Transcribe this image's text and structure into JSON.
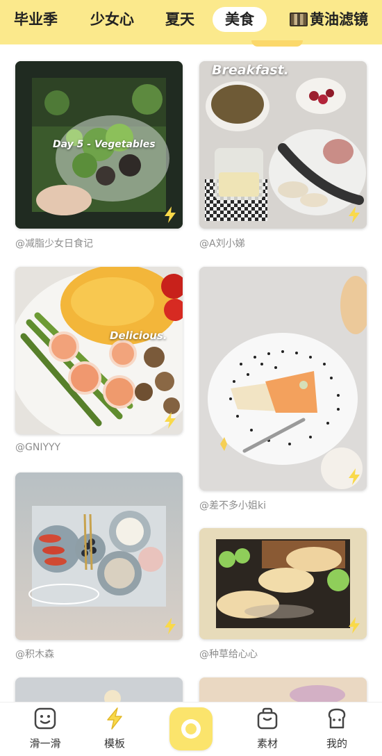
{
  "tabs": [
    {
      "label": "毕业季",
      "active": false
    },
    {
      "label": "少女心",
      "active": false
    },
    {
      "label": "夏天",
      "active": false
    },
    {
      "label": "美食",
      "active": true
    },
    {
      "label": "黄油滤镜",
      "active": false,
      "icon": "film-strip-icon"
    }
  ],
  "posts": [
    {
      "author": "@减脂少女日食记",
      "image_text": "Day 5 - Vegetables",
      "badge_icon": "lightning-icon"
    },
    {
      "author": "@A刘小娣",
      "image_text": "Breakfast.",
      "badge_icon": "lightning-icon"
    },
    {
      "author": "@GNIYYY",
      "image_text": "Delicious.",
      "badge_icon": "lightning-icon"
    },
    {
      "author": "@差不多小姐ki",
      "image_text": "",
      "badge_icon": "lightning-icon"
    },
    {
      "author": "@积木森",
      "image_text": "",
      "badge_icon": "lightning-icon"
    },
    {
      "author": "@种草给心心",
      "image_text": "",
      "badge_icon": "lightning-icon"
    }
  ],
  "nav": [
    {
      "label": "滑一滑",
      "icon": "smile-face-icon"
    },
    {
      "label": "模板",
      "icon": "lightning-icon"
    },
    {
      "label": "",
      "icon": "camera-icon"
    },
    {
      "label": "素材",
      "icon": "bag-icon"
    },
    {
      "label": "我的",
      "icon": "toast-icon"
    }
  ],
  "colors": {
    "accent": "#fbe46c",
    "topbar": "#fbe98c"
  }
}
